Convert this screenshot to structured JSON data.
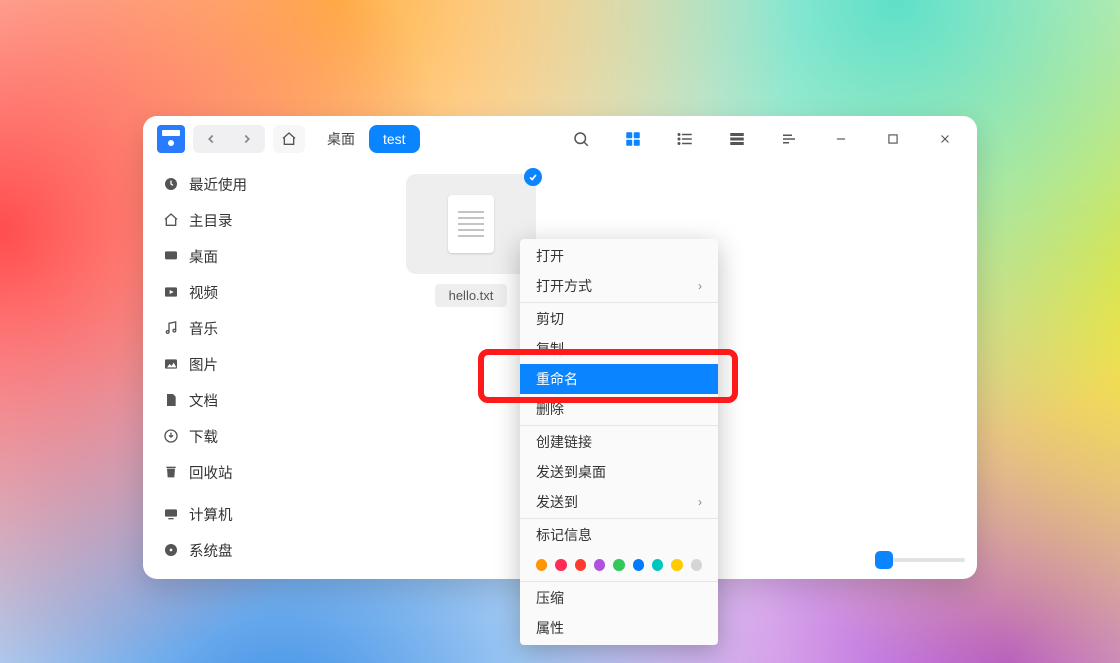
{
  "breadcrumbs": {
    "segment1": "桌面",
    "segment2": "test"
  },
  "sidebar": {
    "items": [
      {
        "label": "最近使用"
      },
      {
        "label": "主目录"
      },
      {
        "label": "桌面"
      },
      {
        "label": "视频"
      },
      {
        "label": "音乐"
      },
      {
        "label": "图片"
      },
      {
        "label": "文档"
      },
      {
        "label": "下载"
      },
      {
        "label": "回收站"
      },
      {
        "label": "计算机"
      },
      {
        "label": "系统盘"
      }
    ]
  },
  "file": {
    "name": "hello.txt"
  },
  "context_menu": {
    "open": "打开",
    "open_with": "打开方式",
    "cut": "剪切",
    "copy": "复制",
    "rename": "重命名",
    "delete": "删除",
    "create_link": "创建链接",
    "send_to_desktop": "发送到桌面",
    "send_to": "发送到",
    "tag_info": "标记信息",
    "compress": "压缩",
    "properties": "属性"
  },
  "tag_colors": [
    "#ff9500",
    "#ff2d55",
    "#ff3b30",
    "#af52de",
    "#34c759",
    "#007aff",
    "#00c7be",
    "#ffcc00"
  ]
}
